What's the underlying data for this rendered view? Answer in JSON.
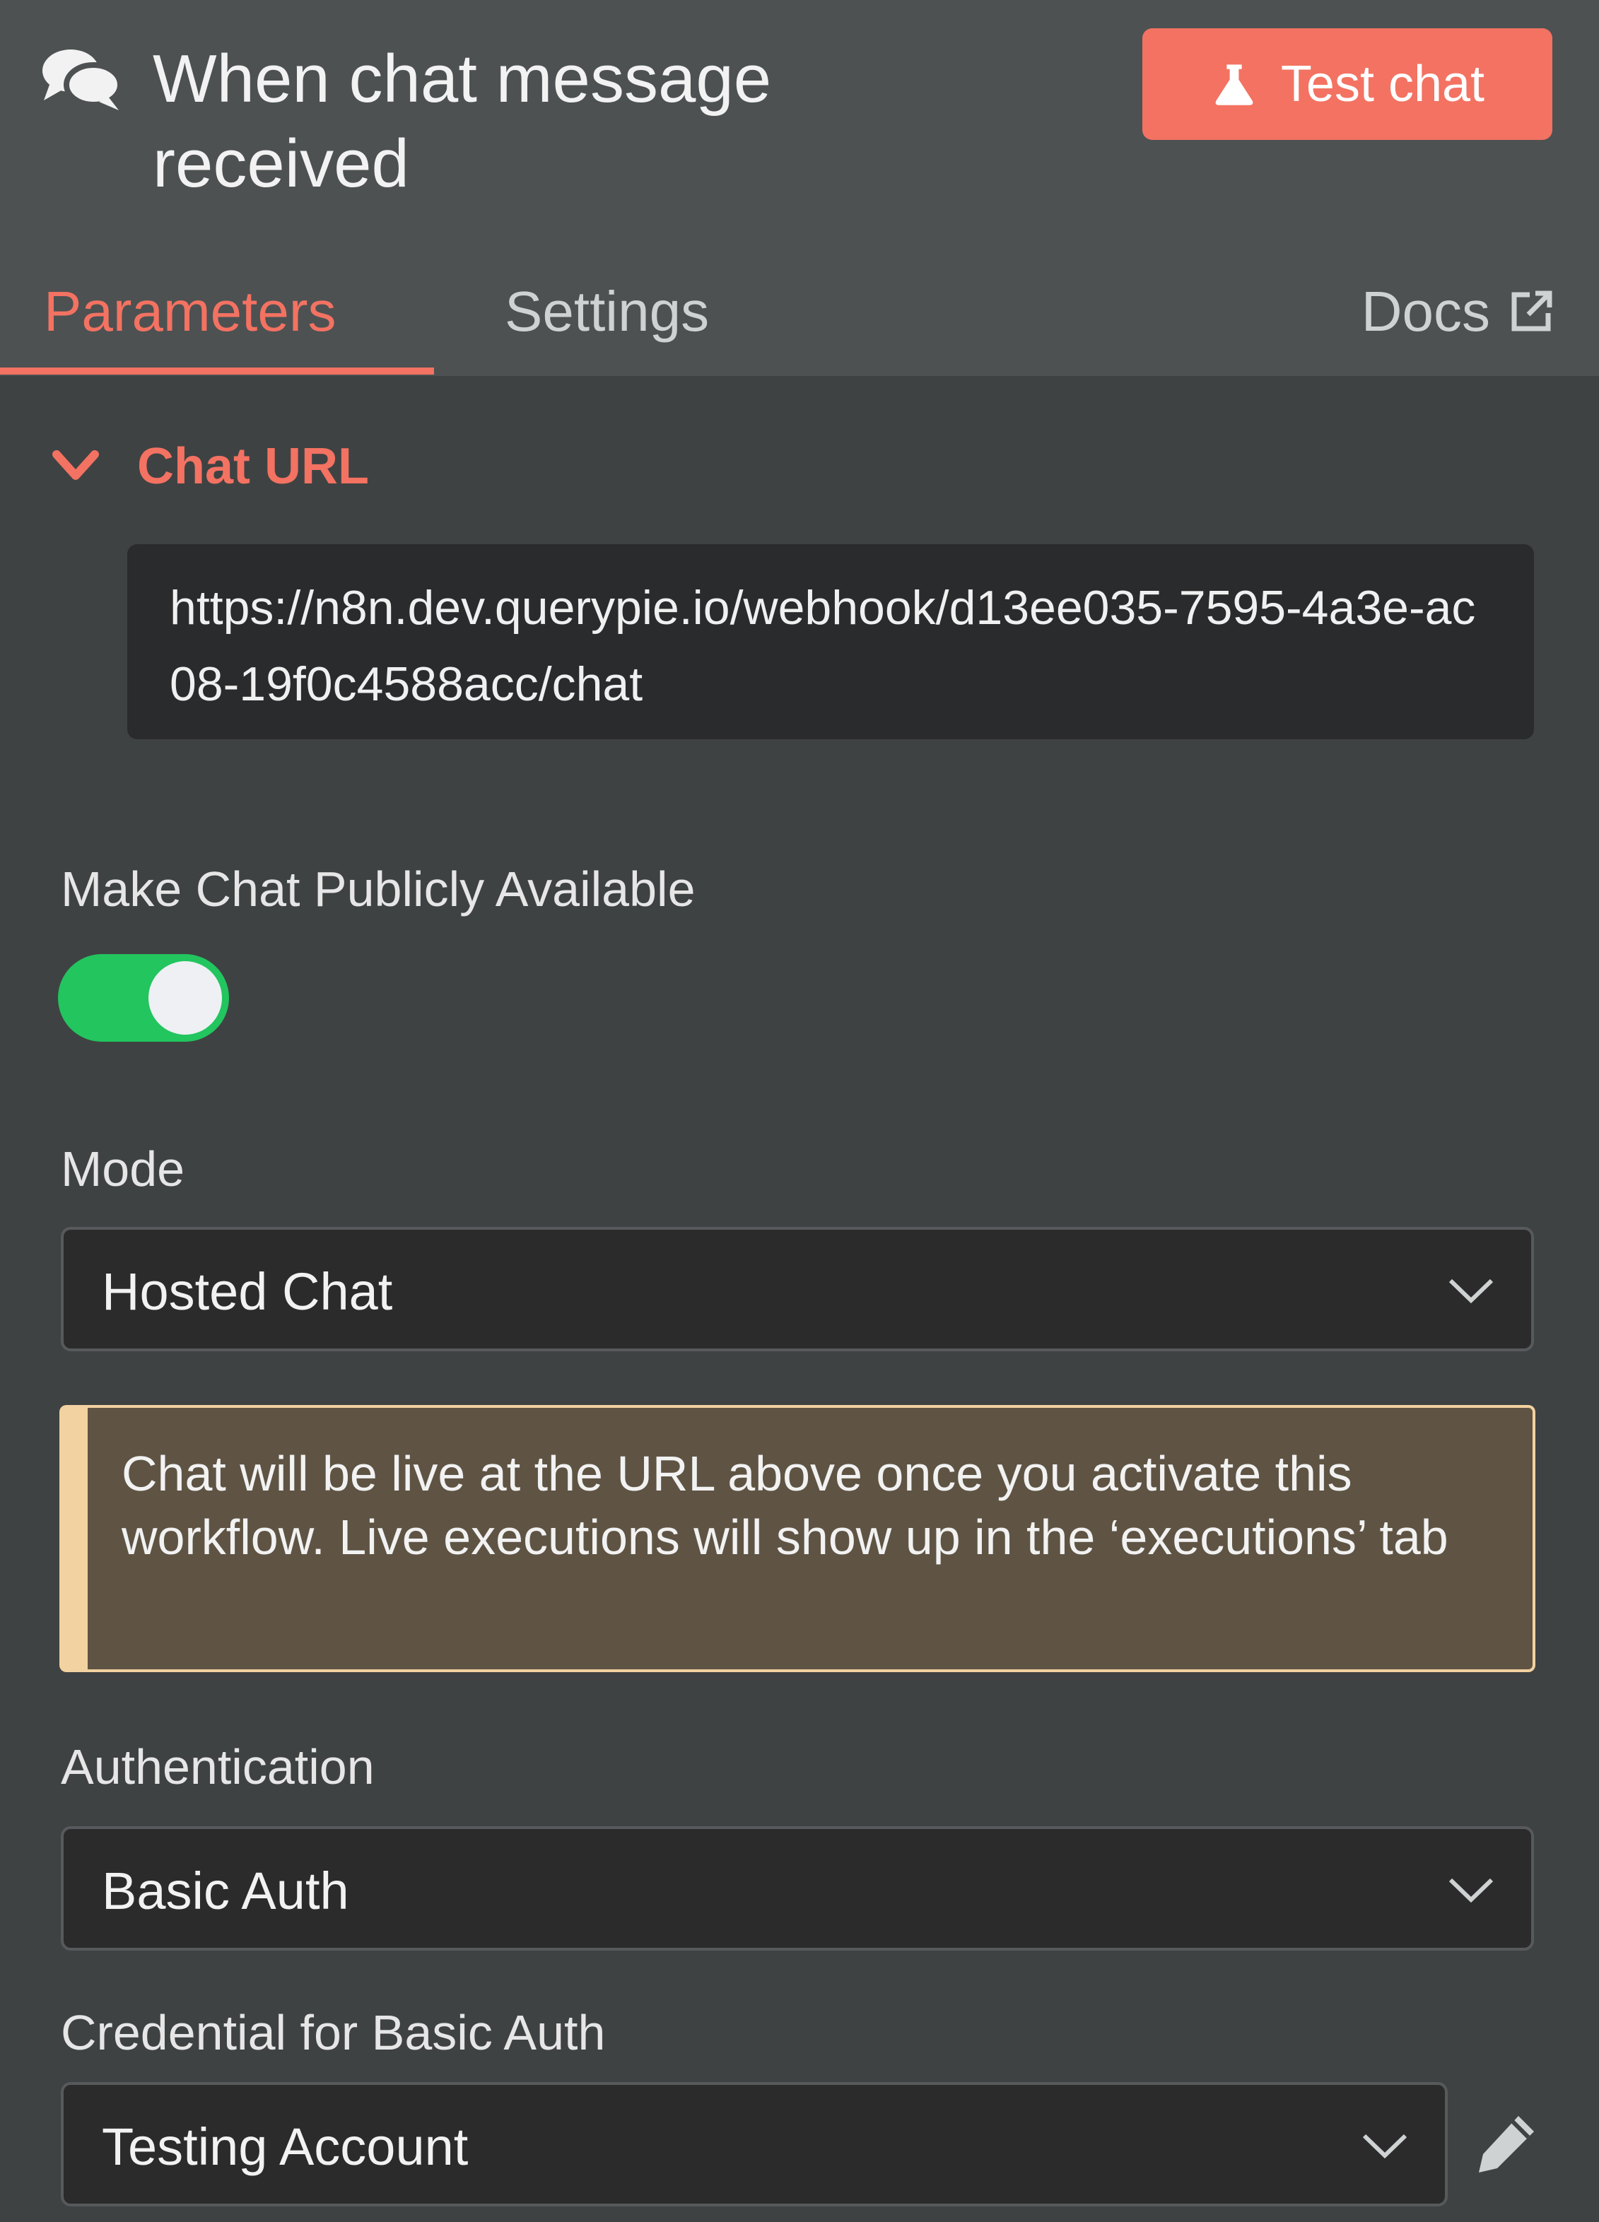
{
  "header": {
    "title": "When chat message received",
    "icon": "chat-bubbles-icon",
    "test_button_label": "Test chat",
    "test_button_icon": "flask-icon",
    "colors": {
      "accent": "#f37262",
      "panel": "#4d5152",
      "background": "#3f4243"
    }
  },
  "tabs": {
    "parameters": "Parameters",
    "settings": "Settings",
    "docs": "Docs",
    "active": "Parameters"
  },
  "chat_url": {
    "section_title": "Chat URL",
    "url": "https://n8n.dev.querypie.io/webhook/d13ee035-7595-4a3e-ac08-19f0c4588acc/chat",
    "expanded": true
  },
  "public_toggle": {
    "label": "Make Chat Publicly Available",
    "enabled": true,
    "color_on": "#22c55e"
  },
  "mode": {
    "label": "Mode",
    "value": "Hosted Chat"
  },
  "notice": {
    "text": "Chat will be live at the URL above once you activate this workflow. Live executions will show up in the ‘executions’ tab"
  },
  "authentication": {
    "label": "Authentication",
    "value": "Basic Auth"
  },
  "credential": {
    "label": "Credential for Basic Auth",
    "value": "Testing Account",
    "edit_icon": "pencil-icon"
  }
}
